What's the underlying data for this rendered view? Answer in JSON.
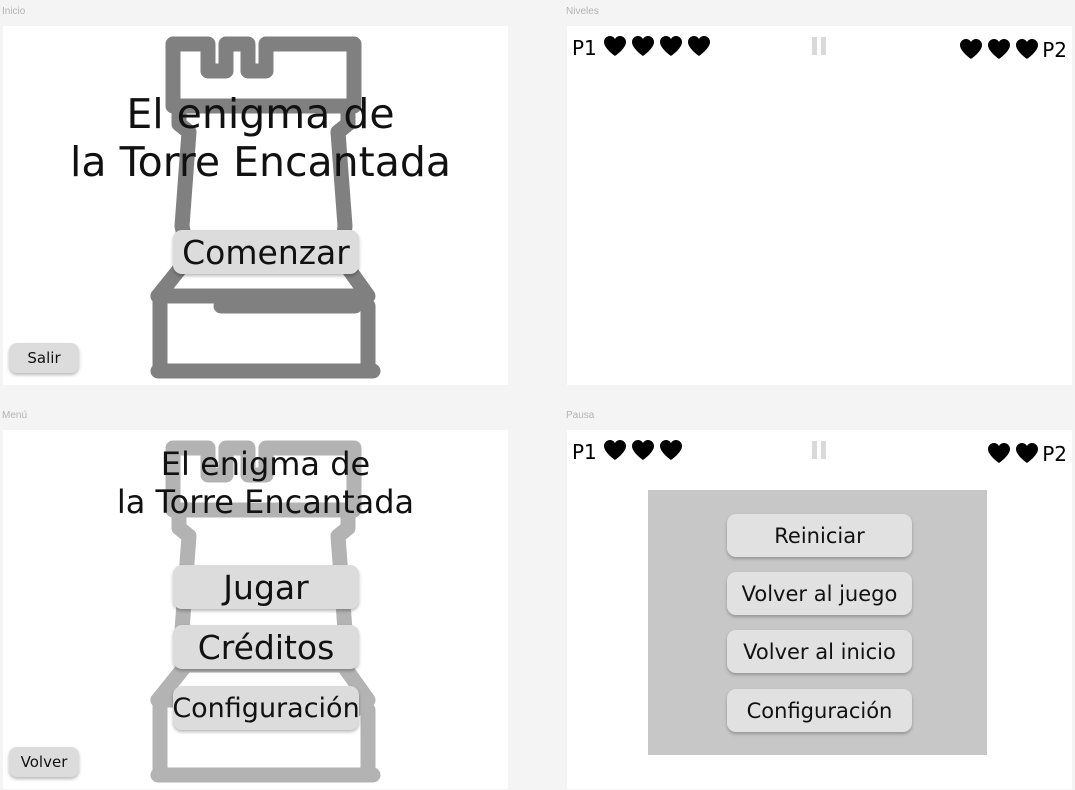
{
  "frames": {
    "inicio": {
      "label": "Inicio",
      "title_line1": "El enigma de",
      "title_line2": "la Torre Encantada",
      "start_label": "Comenzar",
      "exit_label": "Salir"
    },
    "niveles": {
      "label": "Niveles",
      "p1_label": "P1",
      "p1_lives": 4,
      "p2_label": "P2",
      "p2_lives": 3
    },
    "menu": {
      "label": "Menú",
      "title_line1": "El enigma de",
      "title_line2": "la Torre Encantada",
      "play_label": "Jugar",
      "credits_label": "Créditos",
      "settings_label": "Configuración",
      "back_label": "Volver"
    },
    "pausa": {
      "label": "Pausa",
      "p1_label": "P1",
      "p1_lives": 3,
      "p2_label": "P2",
      "p2_lives": 2,
      "restart_label": "Reiniciar",
      "resume_label": "Volver al juego",
      "home_label": "Volver al inicio",
      "settings_label": "Configuración"
    }
  },
  "colors": {
    "tower_dark": "#808080",
    "tower_light": "#b3b3b3",
    "button_bg": "#dcdcdc",
    "pause_panel": "#c7c7c7",
    "pause_icon": "#d9d9d9"
  },
  "icons": {
    "tower": "rook-tower-icon",
    "life": "heart-icon",
    "pause": "pause-icon"
  }
}
